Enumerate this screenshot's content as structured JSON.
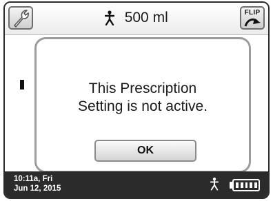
{
  "header": {
    "volume_text": "500 ml",
    "flip_label": "FLIP"
  },
  "dialog": {
    "message_line1": "This Prescription",
    "message_line2": "Setting is not active.",
    "ok_label": "OK"
  },
  "status": {
    "time": "10:11a, Fri",
    "date": "Jun 12, 2015",
    "battery_level": 1.0
  },
  "icons": {
    "settings": "wrench-icon",
    "flip": "flip-arrow-icon",
    "patient": "person-icon",
    "battery": "battery-icon"
  },
  "colors": {
    "status_bar_bg": "#2b2b2b",
    "dialog_border": "#9c9c9c",
    "text": "#1a1a1a"
  }
}
